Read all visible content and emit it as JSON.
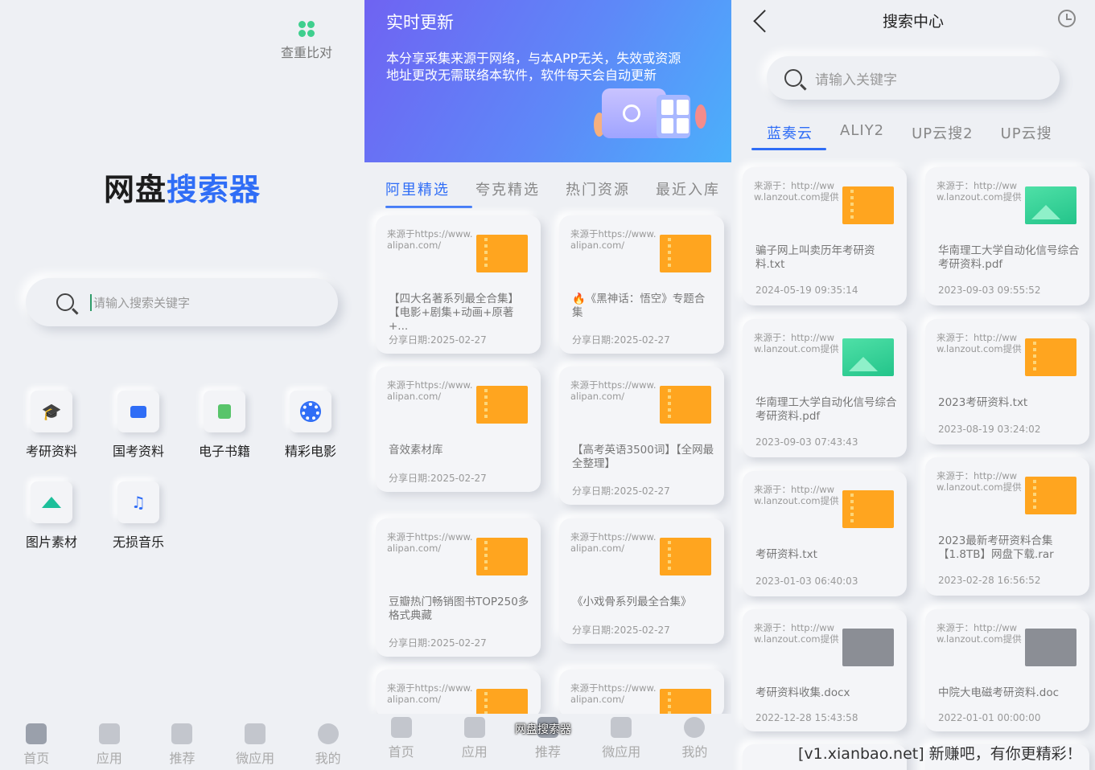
{
  "panel1": {
    "dup_check_label": "查重比对",
    "logo_part1": "网盘",
    "logo_part2": "搜索器",
    "search_placeholder": "请输入搜索关键字",
    "categories": [
      {
        "label": "考研资料",
        "icon": "graduation-cap-icon"
      },
      {
        "label": "国考资料",
        "icon": "monitor-chart-icon"
      },
      {
        "label": "电子书籍",
        "icon": "ebook-icon"
      },
      {
        "label": "精彩电影",
        "icon": "film-reel-icon"
      },
      {
        "label": "图片素材",
        "icon": "landscape-image-icon"
      },
      {
        "label": "无损音乐",
        "icon": "music-note-icon"
      }
    ],
    "bottom_tabs": [
      "首页",
      "应用",
      "推荐",
      "微应用",
      "我的"
    ]
  },
  "panel2": {
    "banner_title": "实时更新",
    "banner_text": "本分享采集来源于网络，与本APP无关，失效或资源地址更改无需联络本软件，软件每天会自动更新",
    "tabs": [
      "阿里精选",
      "夸克精选",
      "热门资源",
      "最近入库"
    ],
    "active_tab": 0,
    "cards": [
      {
        "source": "来源于https://www.alipan.com/",
        "title": "【四大名著系列最全合集】【电影+剧集+动画+原著+...",
        "date": "分享日期:2025-02-27"
      },
      {
        "source": "来源于https://www.alipan.com/",
        "title": "🔥《黑神话：悟空》专题合集",
        "date": "分享日期:2025-02-27"
      },
      {
        "source": "来源于https://www.alipan.com/",
        "title": "音效素材库",
        "date": "分享日期:2025-02-27"
      },
      {
        "source": "来源于https://www.alipan.com/",
        "title": "【高考英语3500词】【全网最全整理】",
        "date": "分享日期:2025-02-27"
      },
      {
        "source": "来源于https://www.alipan.com/",
        "title": "豆瓣热门畅销图书TOP250多格式典藏",
        "date": "分享日期:2025-02-27"
      },
      {
        "source": "来源于https://www.alipan.com/",
        "title": "《小戏骨系列最全合集》",
        "date": "分享日期:2025-02-27"
      },
      {
        "source": "来源于https://www.alipan.com/",
        "title": "",
        "date": ""
      },
      {
        "source": "来源于https://www.alipan.com/",
        "title": "",
        "date": ""
      }
    ],
    "overlay_label": "网盘搜索器",
    "bottom_tabs": [
      "首页",
      "应用",
      "推荐",
      "微应用",
      "我的"
    ]
  },
  "panel3": {
    "title": "搜索中心",
    "search_placeholder": "请输入关键字",
    "tabs": [
      "蓝奏云",
      "ALIY2",
      "UP云搜2",
      "UP云搜"
    ],
    "active_tab": 0,
    "results": [
      {
        "source": "来源于：http://www.lanzout.com提供",
        "title": "骗子网上叫卖历年考研资料.txt",
        "date": "2024-05-19 09:35:14",
        "thumb": "orange"
      },
      {
        "source": "来源于：http://www.lanzout.com提供",
        "title": "华南理工大学自动化信号综合考研资料.pdf",
        "date": "2023-09-03 09:55:52",
        "thumb": "green"
      },
      {
        "source": "来源于：http://www.lanzout.com提供",
        "title": "华南理工大学自动化信号综合考研资料.pdf",
        "date": "2023-09-03 07:43:43",
        "thumb": "green"
      },
      {
        "source": "来源于：http://www.lanzout.com提供",
        "title": "2023考研资料.txt",
        "date": "2023-08-19 03:24:02",
        "thumb": "orange"
      },
      {
        "source": "来源于：http://www.lanzout.com提供",
        "title": "考研资料.txt",
        "date": "2023-01-03 06:40:03",
        "thumb": "orange"
      },
      {
        "source": "来源于：http://www.lanzout.com提供",
        "title": "2023最新考研资料合集【1.8TB】网盘下载.rar",
        "date": "2023-02-28 16:56:52",
        "thumb": "orange"
      },
      {
        "source": "来源于：http://www.lanzout.com提供",
        "title": "考研资料收集.docx",
        "date": "2022-12-28 15:43:58",
        "thumb": "gray"
      },
      {
        "source": "来源于：http://www.lanzout.com提供",
        "title": "中院大电磁考研资料.doc",
        "date": "2022-01-01 00:00:00",
        "thumb": "gray"
      }
    ]
  },
  "watermark": "[v1.xianbao.net] 新赚吧，有你更精彩！",
  "colors": {
    "accent": "#2f6df6",
    "thumb_orange": "#ffa51f",
    "thumb_green": "#23c48a",
    "dup_icon": "#3fcf8e"
  }
}
